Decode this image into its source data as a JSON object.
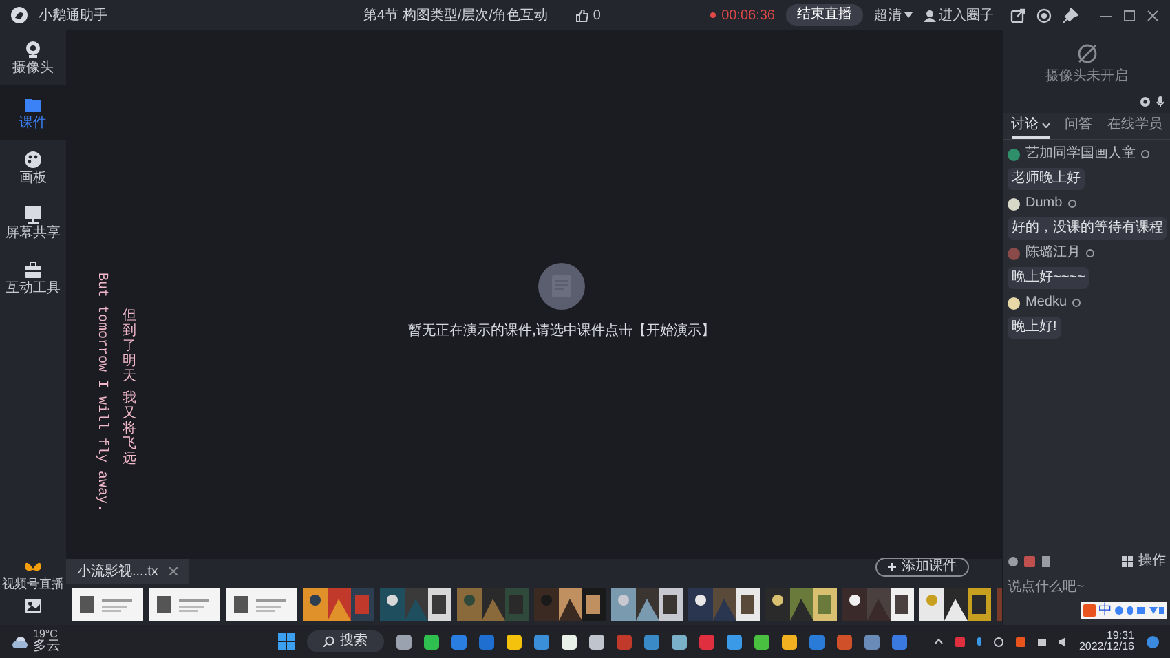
{
  "app": {
    "title": "小鹅通助手"
  },
  "top_bar": {
    "lesson_title": "第4节 构图类型/层次/角色互动",
    "likes": "0",
    "timer": "00:06:36",
    "end_button": "结束直播",
    "quality": "超清",
    "circle_button": "进入圈子"
  },
  "sidebar": {
    "items": [
      {
        "kind": "camera",
        "label": "摄像头",
        "selected": false
      },
      {
        "kind": "courseware",
        "label": "课件",
        "selected": true
      },
      {
        "kind": "palette",
        "label": "画板",
        "selected": false
      },
      {
        "kind": "screen",
        "label": "屏幕共享",
        "selected": false
      },
      {
        "kind": "toolbox",
        "label": "互动工具",
        "selected": false
      }
    ],
    "bottom_label": "视频号直播"
  },
  "stage": {
    "empty_message": "暂无正在演示的课件,请选中课件点击【开始演示】",
    "lyrics": [
      "But tomorrow I will fly away.",
      "但到了明天",
      "我又将飞远"
    ]
  },
  "files": {
    "tabs": [
      {
        "label": "小流影视....tx",
        "selected": true
      }
    ],
    "add_button": "添加课件",
    "thumbnails": [
      {
        "kind": "slide"
      },
      {
        "kind": "slide"
      },
      {
        "kind": "slide"
      },
      {
        "kind": "picture"
      },
      {
        "kind": "picture"
      },
      {
        "kind": "picture"
      },
      {
        "kind": "picture"
      },
      {
        "kind": "picture"
      },
      {
        "kind": "picture"
      },
      {
        "kind": "picture"
      },
      {
        "kind": "picture"
      },
      {
        "kind": "picture"
      },
      {
        "kind": "picture"
      }
    ]
  },
  "right_panel": {
    "camera_status": "摄像头未开启",
    "tabs": [
      {
        "label": "讨论",
        "selected": true
      },
      {
        "label": "问答",
        "selected": false
      },
      {
        "label": "在线学员",
        "selected": false
      }
    ],
    "messages": [
      {
        "author": "艺加同学国画人童",
        "text": "老师晚上好",
        "color": "#2f8f6a"
      },
      {
        "author": "Dumb",
        "text": "好的，没课的等待有课程",
        "color": "#d8d8c8"
      },
      {
        "author": "陈璐江月",
        "text": "晚上好~~~~",
        "color": "#8a4a4a"
      },
      {
        "author": "Medku",
        "text": "晚上好!",
        "color": "#e8d8a8"
      }
    ],
    "operate_button": "操作",
    "input_placeholder": "说点什么吧~",
    "ime_mode": "中"
  },
  "taskbar": {
    "weather_temp": "19°C",
    "weather_text": "多云",
    "search": "搜索",
    "time": "19:31",
    "date": "2022/12/16"
  }
}
